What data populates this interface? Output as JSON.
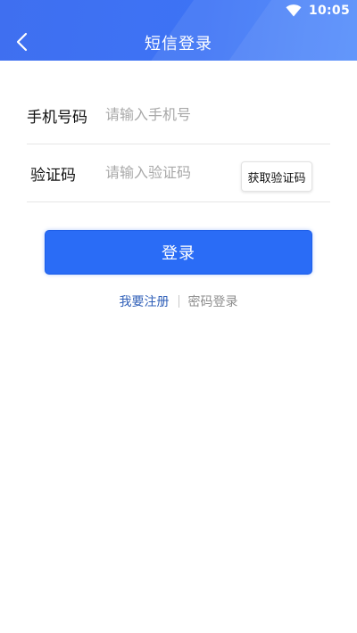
{
  "status_bar": {
    "time": "10:05",
    "wifi_icon": "wifi-icon"
  },
  "header": {
    "title": "短信登录",
    "back_icon": "chevron-left-icon"
  },
  "form": {
    "phone_label": "手机号码",
    "phone_placeholder": "请输入手机号",
    "phone_value": "",
    "code_label": "验证码",
    "code_placeholder": "请输入验证码",
    "code_value": "",
    "get_code_label": "获取验证码"
  },
  "actions": {
    "login_label": "登录",
    "register_label": "我要注册",
    "password_login_label": "密码登录"
  },
  "colors": {
    "header": "#3f6ff0",
    "primary": "#2a6cf6",
    "link": "#2f5fb8",
    "muted": "#8d8d8d"
  }
}
